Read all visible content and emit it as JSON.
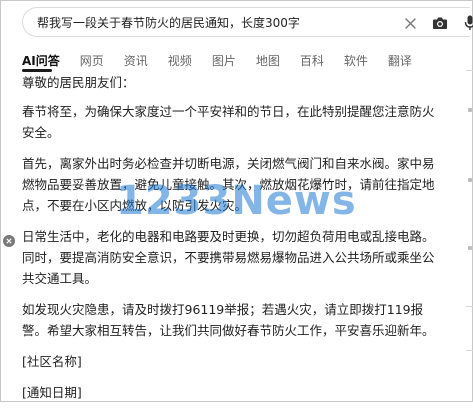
{
  "search": {
    "query": "帮我写一段关于春节防火的居民通知，长度300字",
    "icons": [
      "close-icon",
      "camera-icon",
      "microphone-icon"
    ]
  },
  "tabs": [
    {
      "label": "AI问答",
      "active": true
    },
    {
      "label": "网页",
      "active": false
    },
    {
      "label": "资讯",
      "active": false
    },
    {
      "label": "视频",
      "active": false
    },
    {
      "label": "图片",
      "active": false
    },
    {
      "label": "地图",
      "active": false
    },
    {
      "label": "百科",
      "active": false
    },
    {
      "label": "软件",
      "active": false
    },
    {
      "label": "翻译",
      "active": false
    }
  ],
  "answer": {
    "greeting": "尊敬的居民朋友们：",
    "paragraphs": [
      "春节将至，为确保大家度过一个平安祥和的节日，在此特别提醒您注意防火安全。",
      "首先，离家外出时务必检查并切断电源，关闭燃气阀门和自来水阀。家中易燃物品要妥善放置，避免儿童接触。其次，燃放烟花爆竹时，请前往指定地点，不要在小区内燃放，以防引发火灾。",
      "日常生活中，老化的电器和电路要及时更换，切勿超负荷用电或乱接电路。同时，要提高消防安全意识，不要携带易燃易爆物品进入公共场所或乘坐公共交通工具。",
      "如发现火灾隐患，请及时拨打96119举报；若遇火灾，请立即拨打119报警。希望大家相互转告，让我们共同做好春节防火工作，平安喜乐迎新年。"
    ],
    "community_name": "[社区名称]",
    "notice_date": "[通知日期]"
  },
  "watermark": {
    "text": "1233News",
    "color": "#1e78d2"
  },
  "colors": {
    "accent": "#1a1a1a",
    "text": "#222222",
    "muted": "#666666",
    "border": "#dcdcdc"
  }
}
